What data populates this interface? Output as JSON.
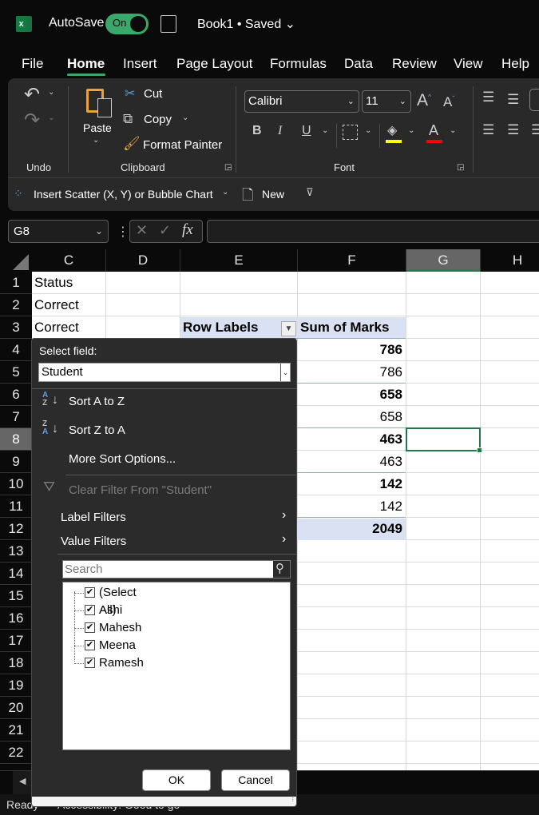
{
  "titlebar": {
    "app_icon": "excel-logo-icon",
    "autosave_label": "AutoSave",
    "autosave_state": "On",
    "document_title": "Book1 • Saved ⌄"
  },
  "menu_tabs": [
    "File",
    "Home",
    "Insert",
    "Page Layout",
    "Formulas",
    "Data",
    "Review",
    "View",
    "Help"
  ],
  "active_tab": "Home",
  "ribbon": {
    "undo_group": "Undo",
    "clipboard": {
      "paste": "Paste",
      "cut": "Cut",
      "copy": "Copy",
      "format_painter": "Format Painter",
      "group": "Clipboard"
    },
    "font": {
      "font_name": "Calibri",
      "font_size": "11",
      "bold": "B",
      "italic": "I",
      "underline": "U",
      "group": "Font",
      "highlight_color": "#ffff00",
      "font_color": "#ff0000"
    },
    "quick_access": {
      "scatter": "Insert Scatter (X, Y) or Bubble Chart",
      "new": "New"
    }
  },
  "formula_bar": {
    "name_box": "G8",
    "formula": ""
  },
  "columns": [
    "C",
    "D",
    "E",
    "F",
    "G",
    "H"
  ],
  "selected_column": "G",
  "rows": [
    "1",
    "2",
    "3",
    "4",
    "5",
    "6",
    "7",
    "8",
    "9",
    "10",
    "11",
    "12",
    "13",
    "14",
    "15",
    "16",
    "17",
    "18",
    "19",
    "20",
    "21",
    "22"
  ],
  "selected_row": "8",
  "cells": {
    "C1": "Status",
    "C2": "Correct",
    "C3": "Correct",
    "E3": "Row Labels",
    "F3": "Sum of Marks",
    "F4": "786",
    "F5": "786",
    "F6": "658",
    "F7": "658",
    "F8": "463",
    "F9": "463",
    "F10": "142",
    "F11": "142",
    "F12": "2049"
  },
  "filter_dropdown": {
    "select_field_label": "Select field:",
    "selected_field": "Student",
    "sort_az": "Sort A to Z",
    "sort_za": "Sort Z to A",
    "more_sort": "More Sort Options...",
    "clear_filter": "Clear Filter From \"Student\"",
    "label_filters": "Label Filters",
    "value_filters": "Value Filters",
    "search_placeholder": "Search",
    "items": [
      {
        "label": "(Select All)",
        "checked": true
      },
      {
        "label": "Ashi",
        "checked": true
      },
      {
        "label": "Mahesh",
        "checked": true
      },
      {
        "label": "Meena",
        "checked": true
      },
      {
        "label": "Ramesh",
        "checked": true
      }
    ],
    "ok": "OK",
    "cancel": "Cancel"
  },
  "status": {
    "ready": "Ready",
    "accessibility": "Accessibility: Good to go"
  }
}
